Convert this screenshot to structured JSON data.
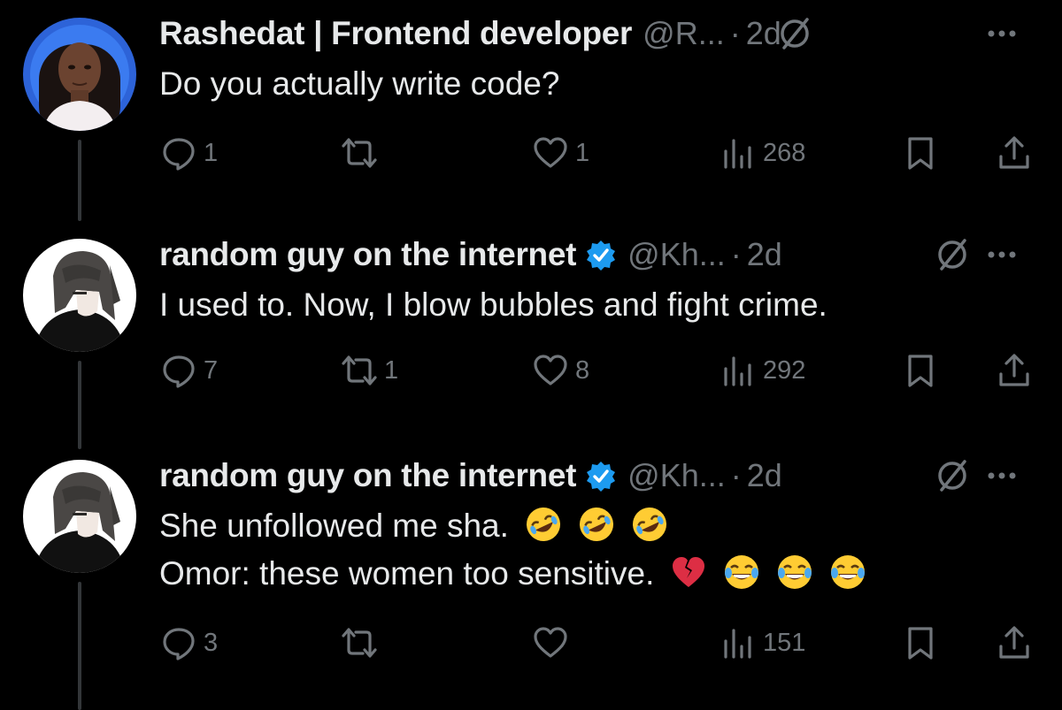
{
  "tweets": [
    {
      "author_name": "Rashedat | Frontend developer",
      "verified": false,
      "handle": "@R...",
      "dot": "·",
      "time": "2d",
      "text_lines": [
        "Do you actually write code?"
      ],
      "replies": "1",
      "retweets": "",
      "likes": "1",
      "views": "268"
    },
    {
      "author_name": "random guy on the internet",
      "verified": true,
      "handle": "@Kh...",
      "dot": "·",
      "time": "2d",
      "text_lines": [
        "I used to. Now, I blow bubbles and fight crime."
      ],
      "replies": "7",
      "retweets": "1",
      "likes": "8",
      "views": "292"
    },
    {
      "author_name": "random guy on the internet",
      "verified": true,
      "handle": "@Kh...",
      "dot": "·",
      "time": "2d",
      "text_lines": [
        "She unfollowed me sha.",
        "Omor: these women too sensitive."
      ],
      "replies": "3",
      "retweets": "",
      "likes": "",
      "views": "151"
    }
  ],
  "icons": {
    "reply": "reply-icon",
    "retweet": "retweet-icon",
    "like": "heart-icon",
    "views": "views-icon",
    "bookmark": "bookmark-icon",
    "share": "share-icon",
    "grok": "grok-icon",
    "more": "more-icon",
    "verified": "verified-badge-icon",
    "emoji_laughing_rolling": "rolling-on-floor-laughing-emoji",
    "emoji_broken_heart": "broken-heart-emoji",
    "emoji_tears_of_joy": "face-with-tears-of-joy-emoji"
  },
  "colors": {
    "background": "#000000",
    "text_primary": "#e7e9ea",
    "text_secondary": "#71767b",
    "verified_blue": "#1d9bf0",
    "thread_line": "#333639"
  }
}
